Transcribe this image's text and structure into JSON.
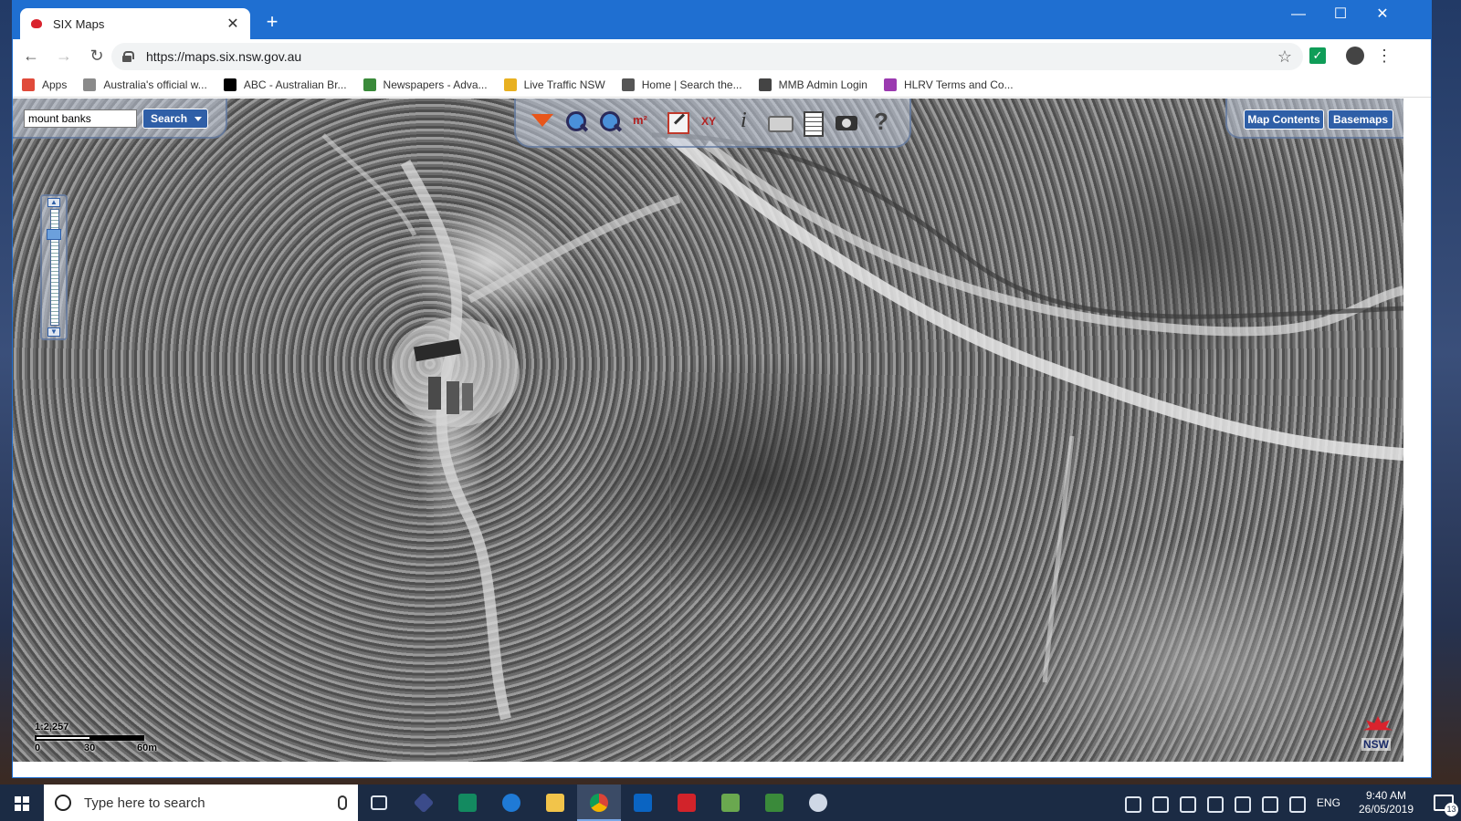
{
  "browser": {
    "tab_title": "SIX Maps",
    "tab_close": "✕",
    "new_tab": "+",
    "url": "https://maps.six.nsw.gov.au",
    "window_controls": {
      "minimize": "—",
      "maximize": "☐",
      "close": "✕"
    }
  },
  "bookmarks": [
    {
      "label": "Apps",
      "color": "#e04a3a"
    },
    {
      "label": "Australia's official w...",
      "color": "#8a8a8a"
    },
    {
      "label": "ABC - Australian Br...",
      "color": "#000000"
    },
    {
      "label": "Newspapers - Adva...",
      "color": "#3a8a3a"
    },
    {
      "label": "Live Traffic NSW",
      "color": "#e8b020"
    },
    {
      "label": "Home | Search the...",
      "color": "#555555"
    },
    {
      "label": "MMB Admin Login",
      "color": "#444444"
    },
    {
      "label": "HLRV Terms and Co...",
      "color": "#9b3ab0"
    }
  ],
  "map": {
    "search": {
      "value": "mount banks",
      "button_label": "Search"
    },
    "right_buttons": {
      "map_contents": "Map Contents",
      "basemaps": "Basemaps"
    },
    "scale": {
      "ratio": "1:2,257",
      "ticks": [
        "0",
        "30",
        "60m"
      ]
    },
    "logo_text": "NSW"
  },
  "taskbar": {
    "search_placeholder": "Type here to search",
    "language": "ENG",
    "time": "9:40 AM",
    "date": "26/05/2019",
    "notifications_count": "13"
  }
}
